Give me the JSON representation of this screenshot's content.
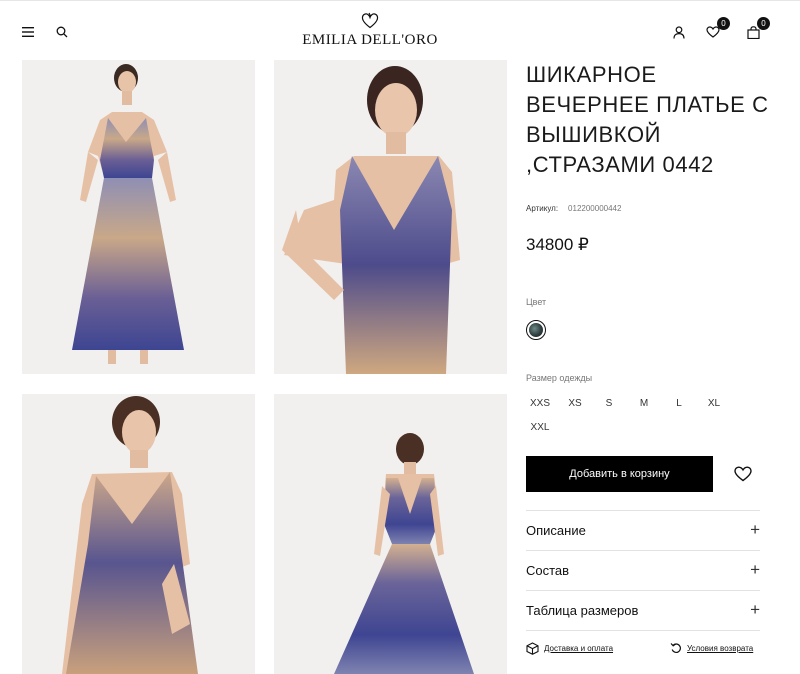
{
  "header": {
    "brand": "EMILIA DELL'ORO",
    "wishlist_count": "0",
    "cart_count": "0"
  },
  "product": {
    "title": "ШИКАРНОЕ ВЕЧЕРНЕЕ ПЛАТЬЕ С ВЫШИВКОЙ ,СТРАЗАМИ 0442",
    "sku_label": "Артикул:",
    "sku_value": "012200000442",
    "price": "34800 ₽",
    "color_label": "Цвет",
    "size_label": "Размер одежды",
    "sizes": [
      "XXS",
      "XS",
      "S",
      "M",
      "L",
      "XL",
      "XXL"
    ],
    "add_to_cart": "Добавить в корзину"
  },
  "accordion": [
    {
      "label": "Описание",
      "icon": "+"
    },
    {
      "label": "Состав",
      "icon": "+"
    },
    {
      "label": "Таблица размеров",
      "icon": "+"
    }
  ],
  "footer_links": {
    "delivery": "Доставка и оплата",
    "returns": "Условия возврата"
  },
  "colors": {
    "accent": "#000000",
    "dress_purple": "#4b4a86",
    "dress_gold": "#cfa880",
    "photo_bg": "#f1f0ee"
  }
}
